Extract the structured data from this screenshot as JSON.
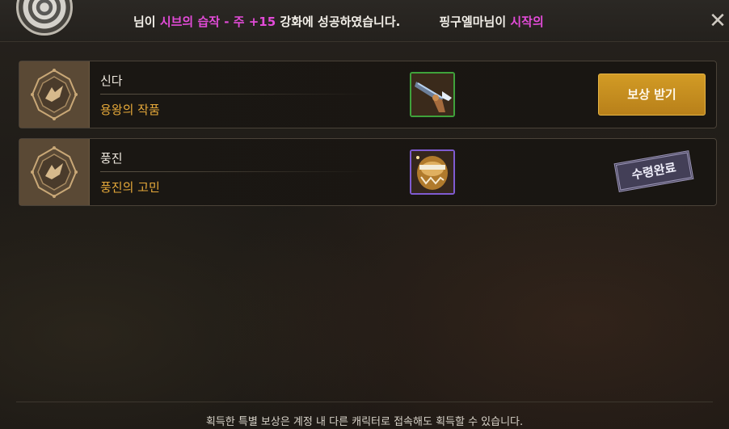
{
  "header": {
    "ticker": {
      "part1": "님이 ",
      "item_name": "시브의 습작 - 주 +15",
      "part2": " 강화에 성공하였습니다.",
      "player2": "핑구엘마님이 ",
      "part3": "시작의"
    },
    "close_label": "✕"
  },
  "rewards": [
    {
      "title": "신다",
      "subtitle": "용왕의 작품",
      "item_icon": "mechanical-crossbow-icon",
      "slot_color": "#3fa23b",
      "action": {
        "type": "button",
        "label": "보상 받기"
      }
    },
    {
      "title": "풍진",
      "subtitle": "풍진의 고민",
      "item_icon": "golden-orb-icon",
      "slot_color": "#7f5bd1",
      "action": {
        "type": "stamp",
        "label": "수령완료"
      }
    }
  ],
  "footer": {
    "note": "획득한 특별 보상은 계정 내 다른 캐릭터로 접속해도 획득할 수 있습니다."
  },
  "colors": {
    "accent_gold": "#d29b25",
    "highlight_magenta": "#e24bd8",
    "subtitle_orange": "#e6a93a"
  }
}
